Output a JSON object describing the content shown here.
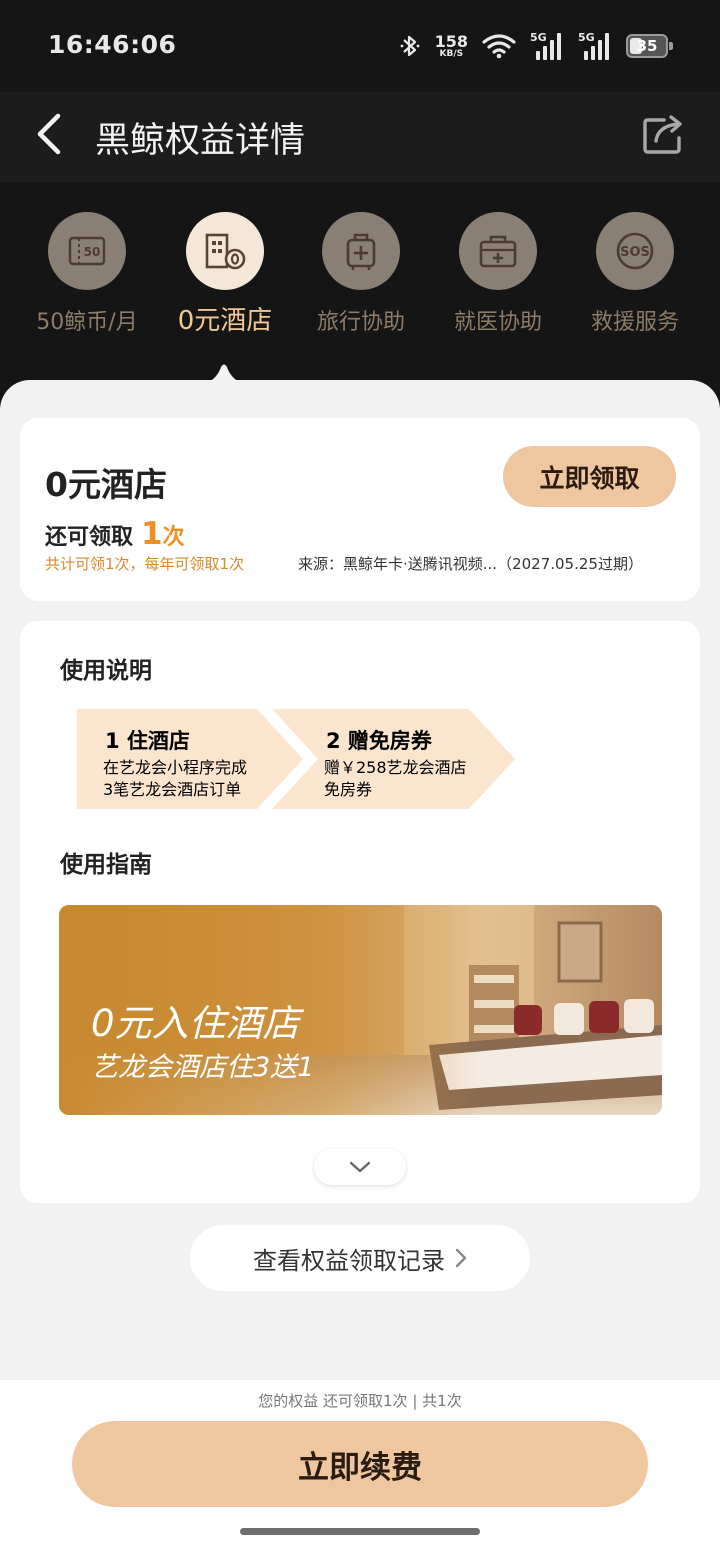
{
  "status_bar": {
    "time": "16:46:06",
    "speed_value": "158",
    "speed_unit": "KB/S",
    "signal1_label": "5G",
    "signal2_label": "5G",
    "battery_level": "35",
    "icons": [
      "bluetooth-icon",
      "wifi-icon",
      "signal-icon",
      "signal-icon",
      "battery-icon"
    ]
  },
  "nav": {
    "title": "黑鲸权益详情",
    "back_icon": "chevron-left-icon",
    "share_icon": "share-icon"
  },
  "tabs": [
    {
      "label": "50鲸币/月",
      "icon": "coin-ticket-icon",
      "active": false
    },
    {
      "label": "0元酒店",
      "icon": "hotel-icon",
      "active": true
    },
    {
      "label": "旅行协助",
      "icon": "luggage-icon",
      "active": false
    },
    {
      "label": "就医协助",
      "icon": "medical-kit-icon",
      "active": false
    },
    {
      "label": "救援服务",
      "icon": "sos-icon",
      "active": false
    }
  ],
  "benefit": {
    "title": "0元酒店",
    "claim_button": "立即领取",
    "remaining_prefix": "还可领取",
    "remaining_count": "1",
    "remaining_unit": "次",
    "limit_text": "共计可领1次，每年可领取1次",
    "source_text": "来源：黑鲸年卡·送腾讯视频...（2027.05.25过期）"
  },
  "usage": {
    "title": "使用说明",
    "steps": [
      {
        "title": "1 住酒店",
        "desc1": "在艺龙会小程序完成",
        "desc2": "3笔艺龙会酒店订单"
      },
      {
        "title": "2 赠免房券",
        "desc1": "赠￥258艺龙会酒店",
        "desc2": "免房券"
      }
    ]
  },
  "guide": {
    "title": "使用指南",
    "banner_line1": "0元入住酒店",
    "banner_line2": "艺龙会酒店住3送1",
    "expand_icon": "chevron-down-icon"
  },
  "record_link": {
    "label": "查看权益领取记录",
    "icon": "chevron-right-icon"
  },
  "footer": {
    "note": "您的权益 还可领取1次 | 共1次",
    "renew_button": "立即续费"
  },
  "colors": {
    "accent": "#eec6a0",
    "highlight": "#ef8f22",
    "dark_bg": "#151515"
  }
}
